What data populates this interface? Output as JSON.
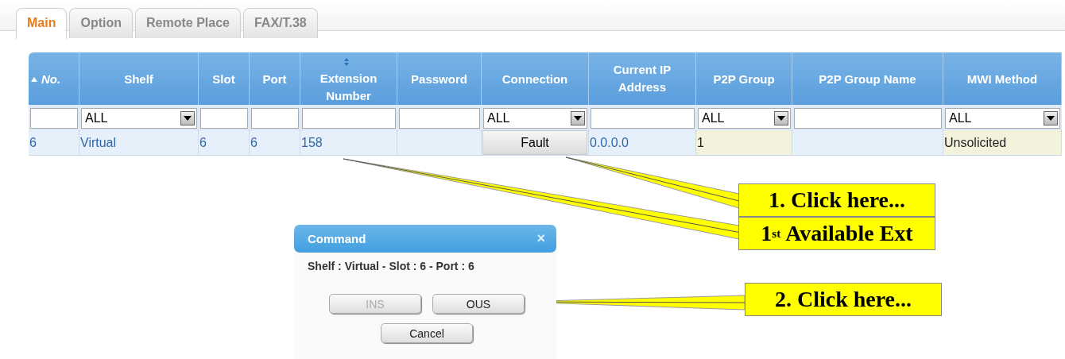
{
  "tabs": [
    {
      "label": "Main",
      "selected": true
    },
    {
      "label": "Option",
      "selected": false
    },
    {
      "label": "Remote Place",
      "selected": false
    },
    {
      "label": "FAX/T.38",
      "selected": false
    }
  ],
  "table": {
    "columns": [
      {
        "label": "No.",
        "sorted_ascending": true,
        "italic": true,
        "filter": {
          "kind": "text"
        }
      },
      {
        "label": "Shelf",
        "filter": {
          "kind": "select",
          "value": "ALL"
        }
      },
      {
        "label": "Slot",
        "filter": {
          "kind": "text"
        }
      },
      {
        "label": "Port",
        "filter": {
          "kind": "text"
        }
      },
      {
        "label": "Extension Number",
        "sort_arrows": true,
        "filter": {
          "kind": "text"
        }
      },
      {
        "label": "Password",
        "filter": {
          "kind": "text"
        }
      },
      {
        "label": "Connection",
        "filter": {
          "kind": "select",
          "value": "ALL"
        }
      },
      {
        "label": "Current IP Address",
        "filter": {
          "kind": "text"
        }
      },
      {
        "label": "P2P Group",
        "filter": {
          "kind": "select",
          "value": "ALL"
        }
      },
      {
        "label": "P2P Group Name",
        "filter": {
          "kind": "text"
        }
      },
      {
        "label": "MWI Method",
        "filter": {
          "kind": "select",
          "value": "ALL"
        }
      }
    ],
    "rows": [
      {
        "cells": [
          {
            "kind": "text",
            "text": "6"
          },
          {
            "kind": "text",
            "text": "Virtual"
          },
          {
            "kind": "text",
            "text": "6"
          },
          {
            "kind": "text",
            "text": "6"
          },
          {
            "kind": "text",
            "text": "158"
          },
          {
            "kind": "text"
          },
          {
            "kind": "button",
            "text": "Fault"
          },
          {
            "kind": "text",
            "text": "0.0.0.0"
          },
          {
            "kind": "text",
            "text": "1",
            "shaded": true
          },
          {
            "kind": "text"
          },
          {
            "kind": "text",
            "text": "Unsolicited",
            "shaded": true
          }
        ]
      }
    ]
  },
  "dialog": {
    "title": "Command",
    "close": "×",
    "message": "Shelf : Virtual - Slot : 6 - Port : 6",
    "buttons": [
      {
        "label": "INS",
        "disabled": true
      },
      {
        "label": "OUS",
        "disabled": false
      },
      {
        "label": "Cancel",
        "disabled": false
      }
    ]
  },
  "callouts": [
    {
      "text": "1. Click here..."
    },
    {
      "text": "1$^{st}$ Available Ext"
    },
    {
      "text": "2. Click here..."
    }
  ]
}
